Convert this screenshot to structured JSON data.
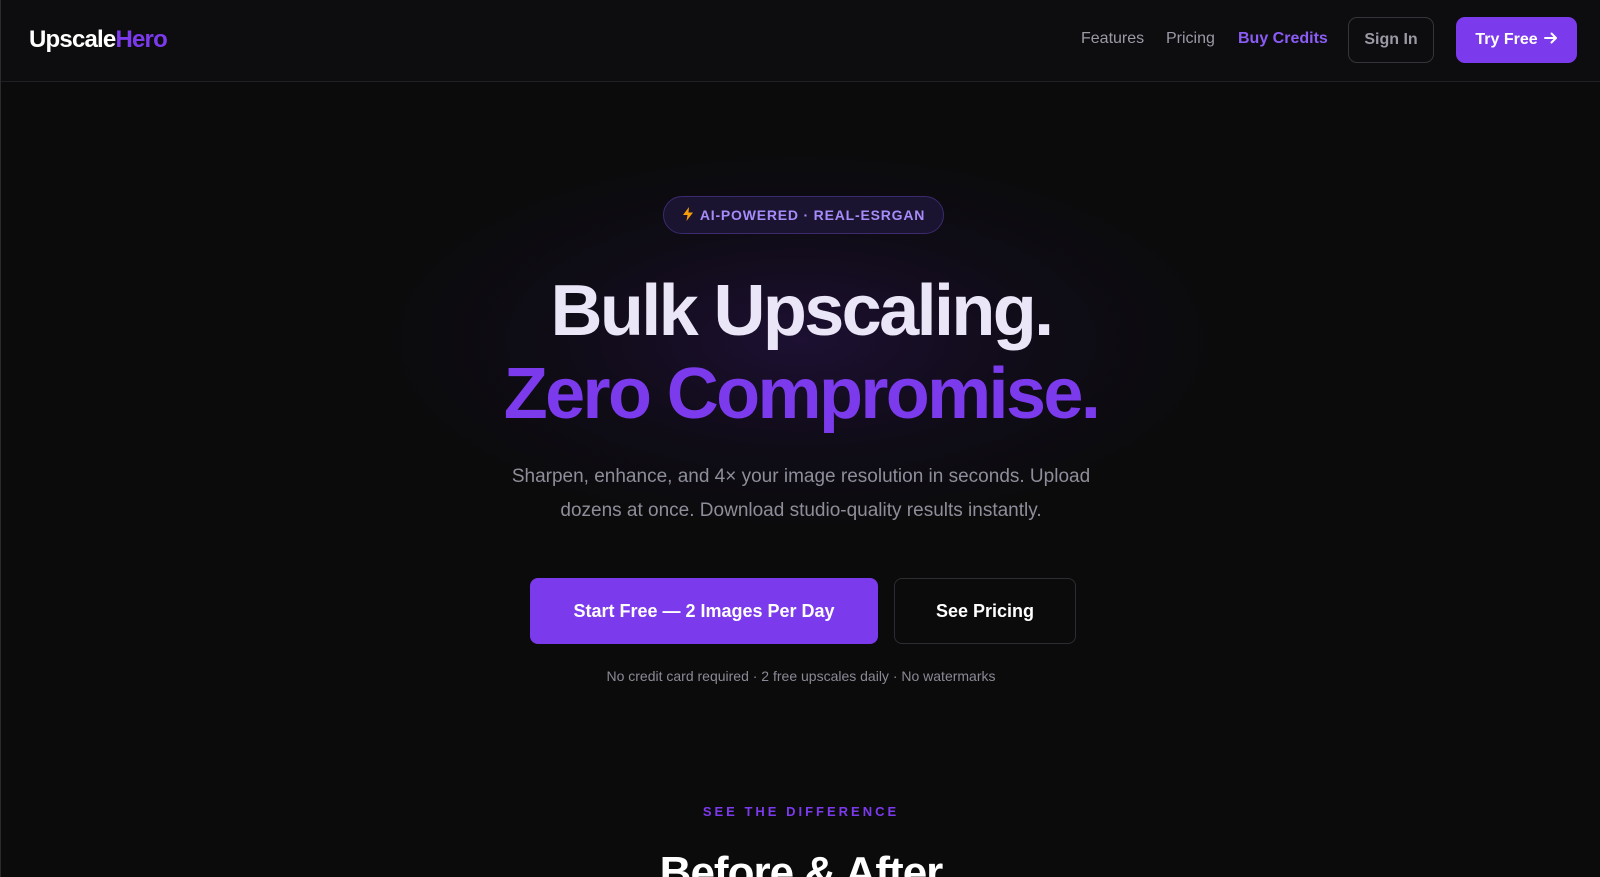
{
  "nav": {
    "logo_part1": "Upscale",
    "logo_part2": "Hero",
    "links": {
      "features": "Features",
      "pricing": "Pricing",
      "buy_credits": "Buy Credits"
    },
    "sign_in": "Sign In",
    "try_free": "Try Free",
    "try_free_icon": "arrow-right-icon"
  },
  "hero": {
    "badge_icon": "lightning-icon",
    "badge_text": "AI-POWERED · REAL-ESRGAN",
    "headline_line1": "Bulk Upscaling.",
    "headline_line2": "Zero Compromise.",
    "subtitle": "Sharpen, enhance, and 4× your image resolution in seconds. Upload dozens at once. Download studio-quality results instantly.",
    "primary_cta": "Start Free — 2 Images Per Day",
    "secondary_cta": "See Pricing",
    "fineprint": "No credit card required · 2 free upscales daily · No watermarks"
  },
  "comparison": {
    "label": "SEE THE DIFFERENCE",
    "title": "Before & After"
  },
  "colors": {
    "accent": "#7c3aed",
    "background": "#0b0b0c",
    "badge_text": "#a78bfa"
  }
}
